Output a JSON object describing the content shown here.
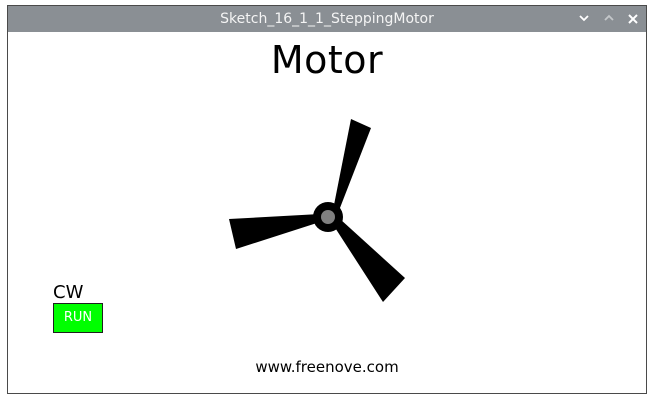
{
  "window": {
    "title": "Sketch_16_1_1_SteppingMotor",
    "controls": {
      "minimize_icon": "chevron-down-icon",
      "maximize_icon": "chevron-up-icon",
      "close_icon": "close-icon"
    },
    "titlebar_color": "#8a8f94"
  },
  "main": {
    "heading": "Motor",
    "direction_label": "CW",
    "run_button_label": "RUN",
    "run_button_color": "#00ff00",
    "footer": "www.freenove.com"
  },
  "motor": {
    "icon": "propeller-icon",
    "blade_count": 3,
    "blade_color": "#000000",
    "hub_color": "#808080"
  }
}
